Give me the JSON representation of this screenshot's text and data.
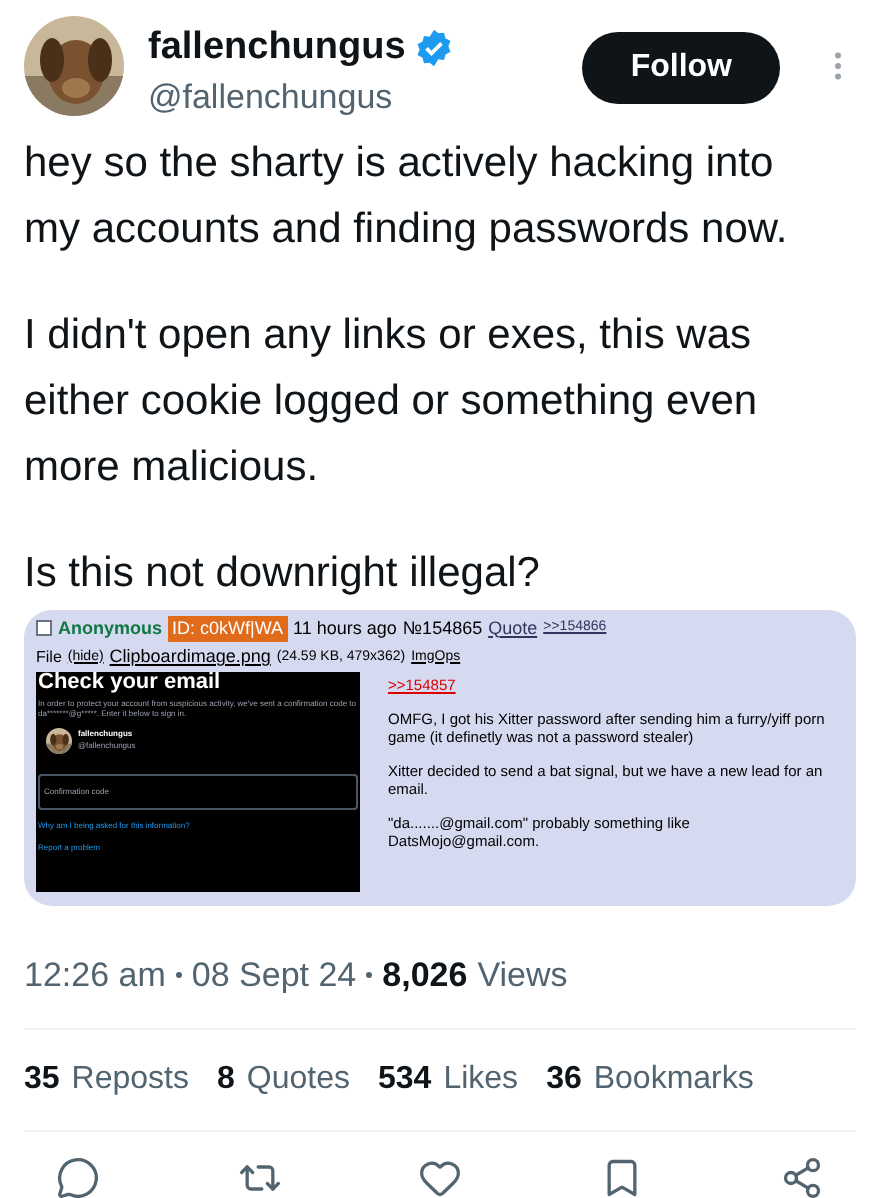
{
  "author": {
    "name": "fallenchungus",
    "handle": "@fallenchungus",
    "verified": true
  },
  "follow_button": "Follow",
  "text": [
    "hey so the sharty is actively hacking into my accounts and finding passwords now.",
    "I didn't open any links or exes, this was either cookie logged or something even more malicious.",
    "Is this not downright illegal?"
  ],
  "attached_screenshot": {
    "post": {
      "checked": false,
      "name": "Anonymous",
      "id": "ID: c0kWf|WA",
      "time": "11 hours ago",
      "number": "№154865",
      "quote": "Quote",
      "backlink": ">>154866",
      "file_label": "File",
      "file_hide": "(hide)",
      "file_name": "Clipboardimage.png",
      "file_info": "(24.59 KB, 479x362)",
      "imgops": "ImgOps",
      "reply_link": ">>154857",
      "paragraphs": [
        "OMFG, I got his Xitter password after sending him a furry/yiff porn game (it definetly was not a password stealer)",
        "Xitter decided to send a bat signal, but we have a new lead for an email.",
        "\"da.......@gmail.com\" probably something like DatsMojo@gmail.com."
      ]
    },
    "email_check": {
      "title": "Check your email",
      "body": "In order to protect your account from suspicious activity, we've sent a confirmation code to da*******@g*****. Enter it below to sign in.",
      "name": "fallenchungus",
      "handle": "@fallenchungus",
      "field_placeholder": "Confirmation code",
      "why_link": "Why am I being asked for this information?",
      "report_link": "Report a problem"
    }
  },
  "timestamp": {
    "time": "12:26 am",
    "date": "08 Sept 24",
    "views_count": "8,026",
    "views_label": "Views"
  },
  "stats": [
    {
      "count": "35",
      "label": "Reposts"
    },
    {
      "count": "8",
      "label": "Quotes"
    },
    {
      "count": "534",
      "label": "Likes"
    },
    {
      "count": "36",
      "label": "Bookmarks"
    }
  ],
  "actions": [
    {
      "kind": "reply"
    },
    {
      "kind": "repost"
    },
    {
      "kind": "like"
    },
    {
      "kind": "bookmark"
    },
    {
      "kind": "share"
    }
  ]
}
